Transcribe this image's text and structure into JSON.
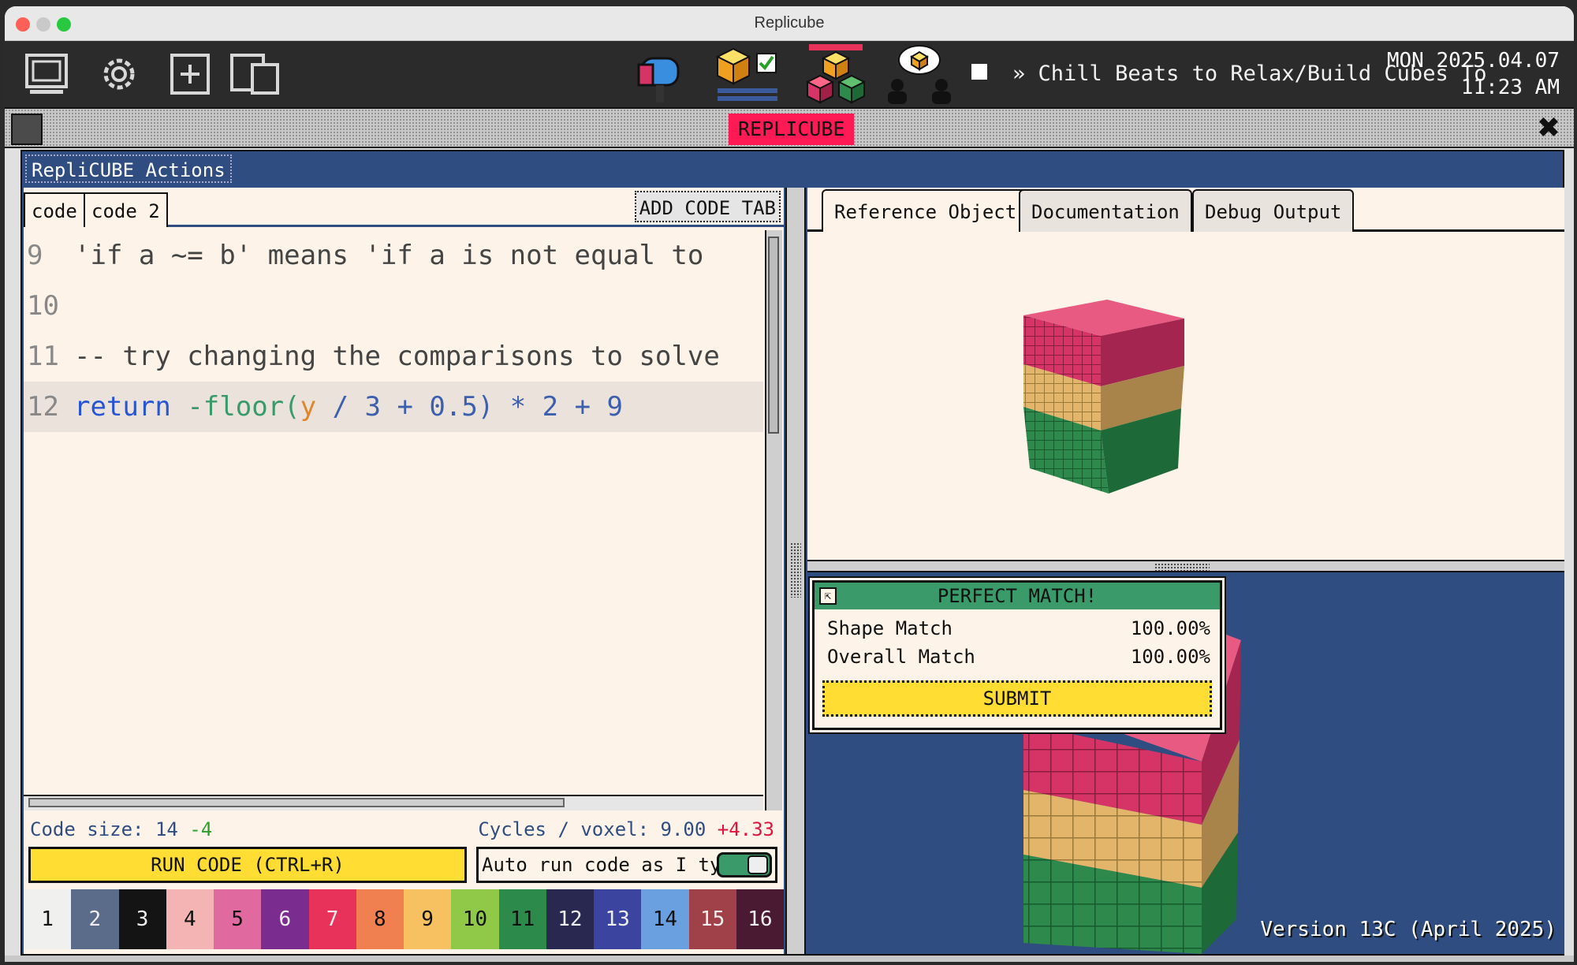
{
  "window": {
    "title": "Replicube"
  },
  "taskbar": {
    "music_title": "Chill Beats to Relax/Build Cubes To",
    "clock_day_date": "MON 2025.04.07",
    "clock_time": "11:23 AM",
    "icons": [
      "monitor-icon",
      "gear-icon",
      "new-file-icon",
      "copy-window-icon",
      "mailbox-icon",
      "cube-checklist-icon",
      "cube-stack-icon",
      "people-cube-icon"
    ]
  },
  "app_strip": {
    "badge": "REPLICUBE"
  },
  "actions": {
    "title": "RepliCUBE Actions"
  },
  "editor": {
    "tabs": [
      "code",
      "code 2"
    ],
    "add_tab_label": "ADD CODE TAB",
    "lines": [
      {
        "n": "9",
        "text": "'if a ~= b' means 'if a is not equal to"
      },
      {
        "n": "10",
        "text": ""
      },
      {
        "n": "11",
        "text": "-- try changing the comparisons to solve"
      },
      {
        "n": "12",
        "kw": "return",
        "fn": "-floor(",
        "var": "y",
        "rest": " / 3 + 0.5)",
        "tail": " * 2 + 9"
      }
    ],
    "code_size_label": "Code size: 14",
    "code_size_delta": "-4",
    "cycles_label": "Cycles / voxel: 9.00",
    "cycles_delta": "+4.33",
    "run_label": "RUN CODE (CTRL+R)",
    "autorun_label": "Auto run code as I type",
    "autorun_on": true
  },
  "palette": [
    {
      "n": "1",
      "bg": "#f0f0ee",
      "fg": "#111"
    },
    {
      "n": "2",
      "bg": "#5b6b8a",
      "fg": "#eee"
    },
    {
      "n": "3",
      "bg": "#141414",
      "fg": "#eee"
    },
    {
      "n": "4",
      "bg": "#f4b4b4",
      "fg": "#111"
    },
    {
      "n": "5",
      "bg": "#e06aa0",
      "fg": "#111"
    },
    {
      "n": "6",
      "bg": "#7a2d8f",
      "fg": "#eee"
    },
    {
      "n": "7",
      "bg": "#e8325a",
      "fg": "#eee"
    },
    {
      "n": "8",
      "bg": "#f08050",
      "fg": "#111"
    },
    {
      "n": "9",
      "bg": "#f7c060",
      "fg": "#111"
    },
    {
      "n": "10",
      "bg": "#90c848",
      "fg": "#111"
    },
    {
      "n": "11",
      "bg": "#2c8a4a",
      "fg": "#111"
    },
    {
      "n": "12",
      "bg": "#282850",
      "fg": "#eee"
    },
    {
      "n": "13",
      "bg": "#3b45a0",
      "fg": "#eee"
    },
    {
      "n": "14",
      "bg": "#6aa0e0",
      "fg": "#111"
    },
    {
      "n": "15",
      "bg": "#a04048",
      "fg": "#eee"
    },
    {
      "n": "16",
      "bg": "#4a1a32",
      "fg": "#eee"
    }
  ],
  "right": {
    "tabs": [
      "Reference Object",
      "Documentation",
      "Debug Output"
    ],
    "active_tab": "Reference Object",
    "version": "Version 13C (April 2025)"
  },
  "match_popup": {
    "title": "PERFECT MATCH!",
    "shape_label": "Shape Match",
    "shape_value": "100.00%",
    "overall_label": "Overall Match",
    "overall_value": "100.00%",
    "submit_label": "SUBMIT"
  },
  "cube_colors": {
    "top": "#d63466",
    "middle": "#e2b56a",
    "bottom": "#2e8a4c"
  }
}
